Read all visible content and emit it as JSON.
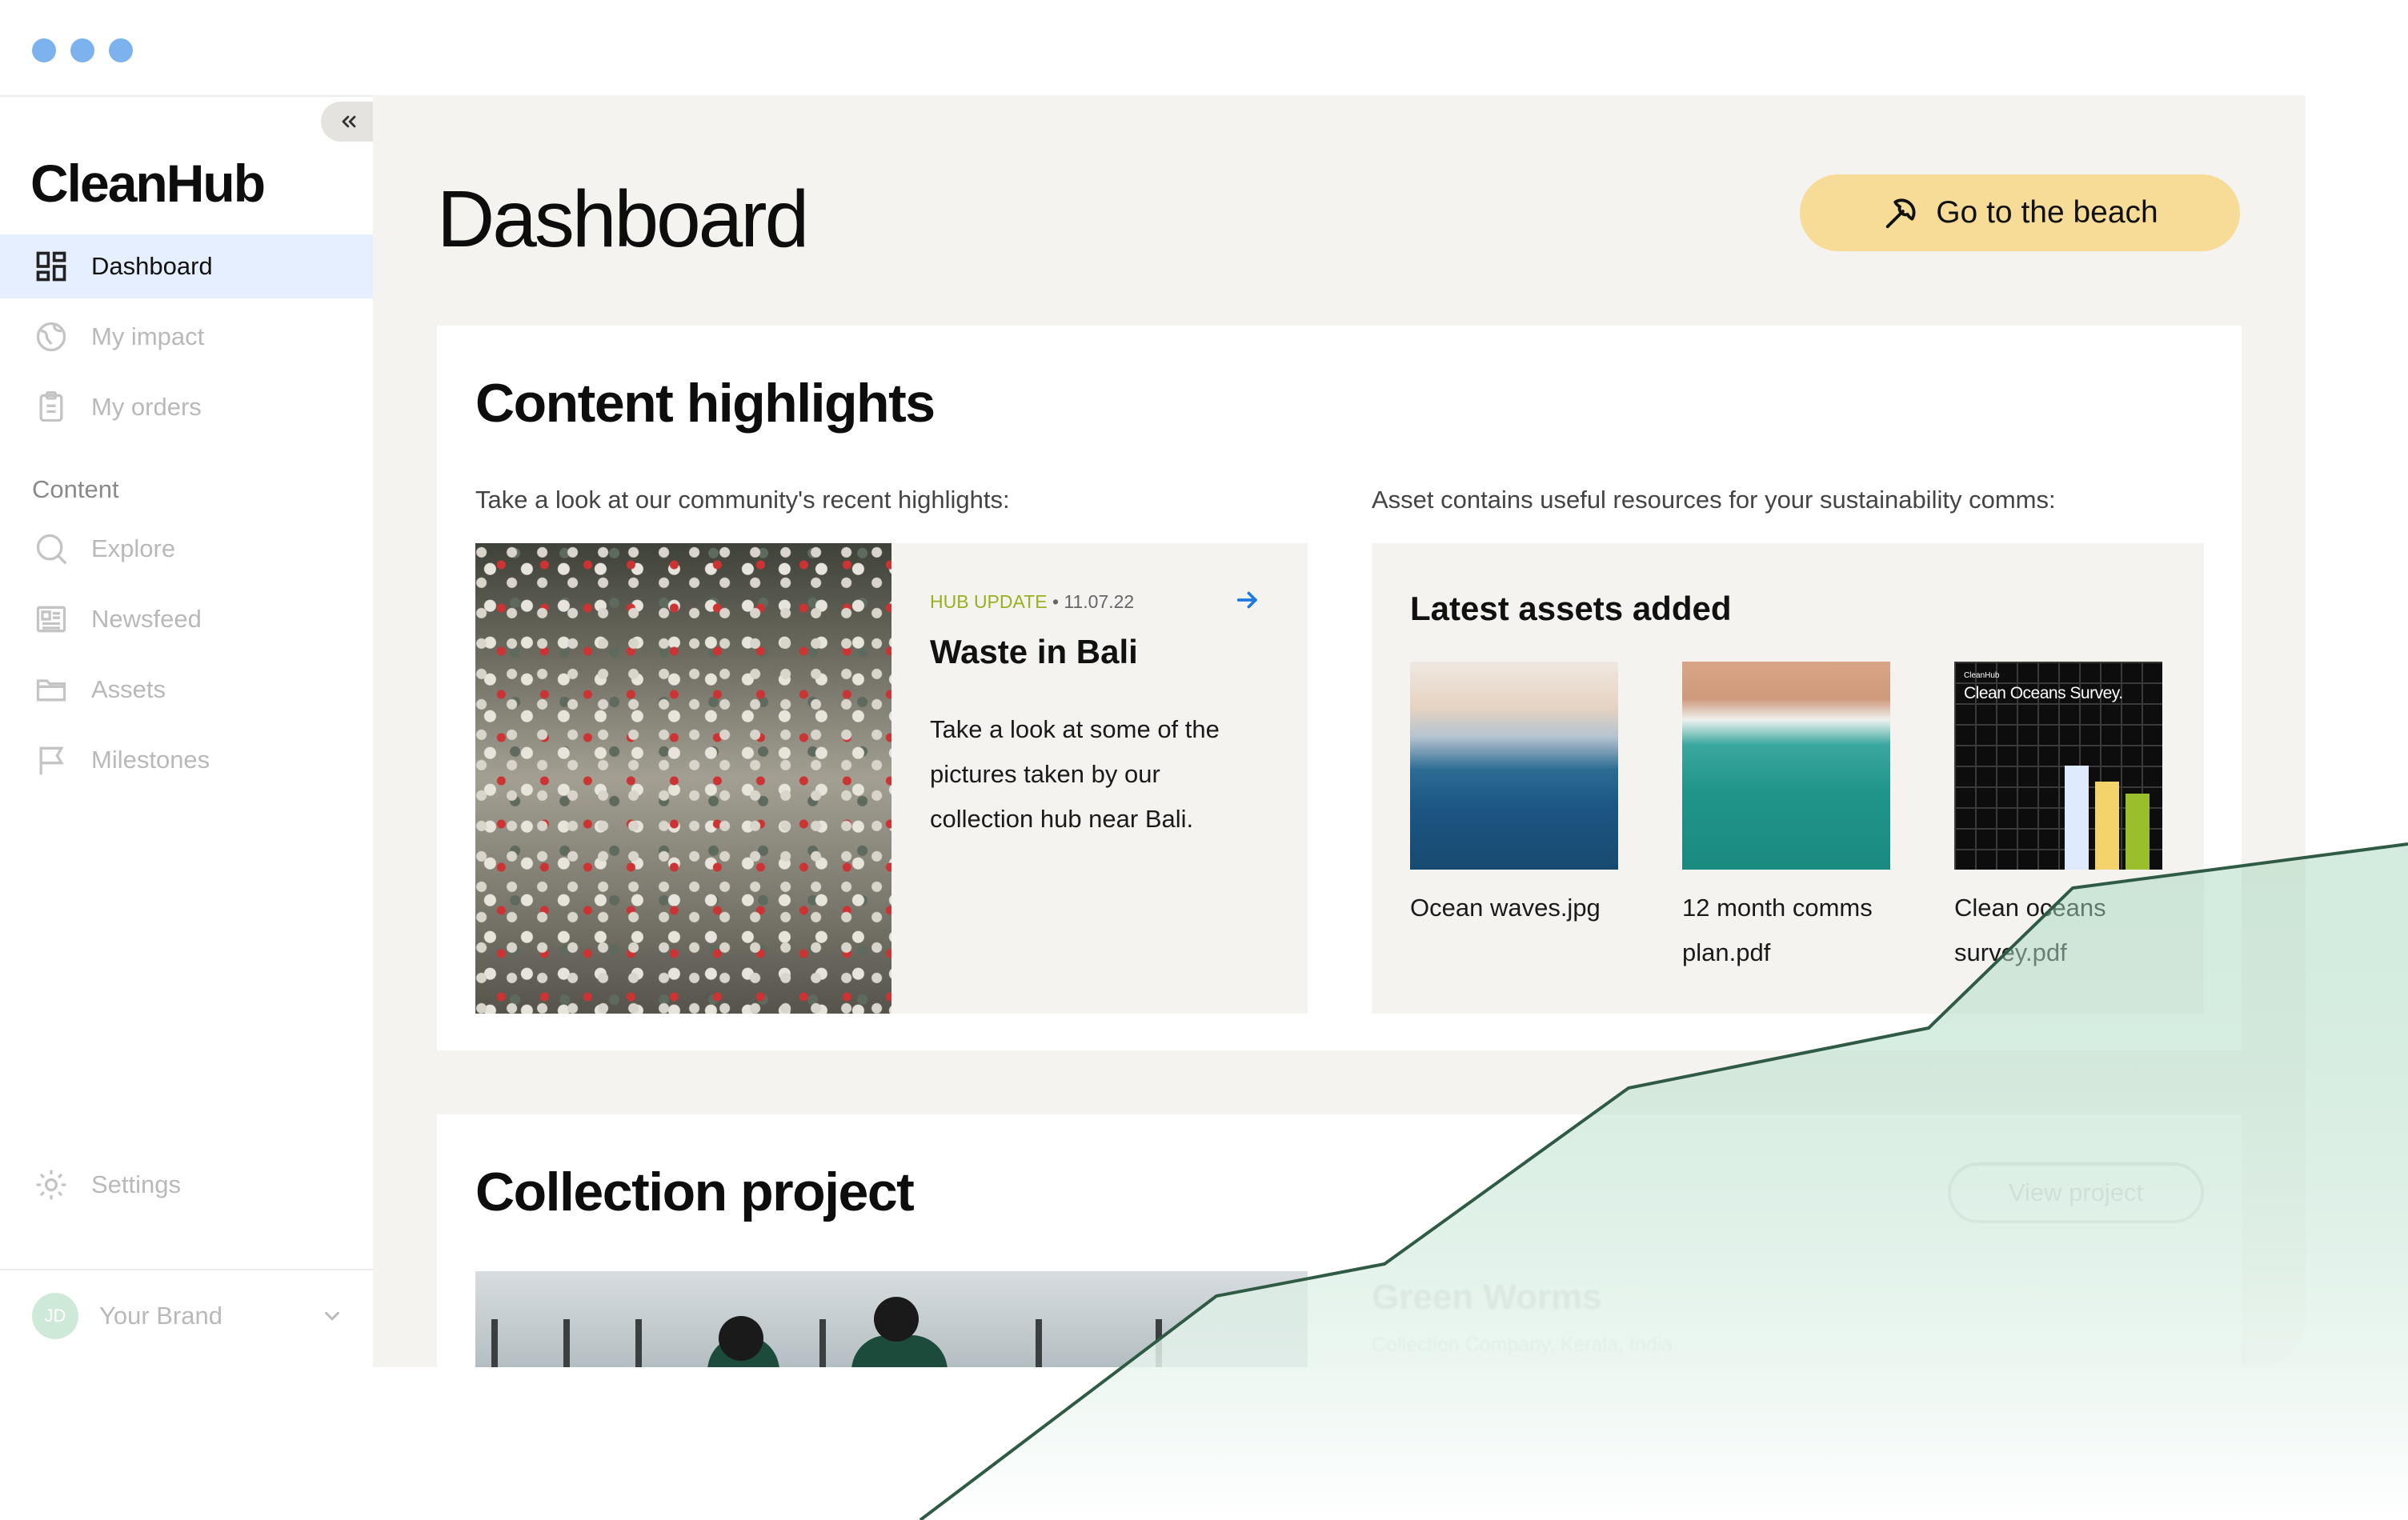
{
  "window": {
    "dots": [
      "dot-1",
      "dot-2",
      "dot-3"
    ]
  },
  "sidebar": {
    "logo": "CleanHub",
    "collapse_icon": "chevrons-left-icon",
    "items": [
      {
        "label": "Dashboard",
        "icon": "dashboard-icon",
        "active": true
      },
      {
        "label": "My impact",
        "icon": "globe-icon",
        "active": false
      },
      {
        "label": "My orders",
        "icon": "clipboard-icon",
        "active": false
      }
    ],
    "section_label": "Content",
    "content_items": [
      {
        "label": "Explore",
        "icon": "search-icon"
      },
      {
        "label": "Newsfeed",
        "icon": "newspaper-icon"
      },
      {
        "label": "Assets",
        "icon": "folder-icon"
      },
      {
        "label": "Milestones",
        "icon": "flag-icon"
      }
    ],
    "settings_label": "Settings",
    "brand": {
      "initials": "JD",
      "name": "Your Brand"
    }
  },
  "main": {
    "title": "Dashboard",
    "cta_label": "Go to the beach",
    "highlights": {
      "title": "Content highlights",
      "left_subtitle": "Take a look at our community's recent highlights:",
      "right_subtitle": "Asset contains useful resources for your sustainability comms:",
      "news": {
        "tag": "HUB UPDATE",
        "date": "• 11.07.22",
        "title": "Waste in Bali",
        "body": "Take a look at some of the pictures taken by our collection hub near Bali."
      },
      "assets": {
        "title": "Latest assets added",
        "items": [
          {
            "name": "Ocean waves.jpg"
          },
          {
            "name": "12 month comms plan.pdf"
          },
          {
            "name": "Clean oceans survey.pdf"
          }
        ],
        "survey_brand": "CleanHub",
        "survey_title": "Clean Oceans Survey."
      }
    },
    "project": {
      "title": "Collection project",
      "view_label": "View project",
      "name": "Green Worms",
      "location": "Collection Company, Kerala, India"
    }
  },
  "colors": {
    "accent_blue": "#e5efff",
    "cta_yellow": "#f7dc97",
    "tag_green": "#9bb01f",
    "growth_line": "#2f5a44"
  }
}
